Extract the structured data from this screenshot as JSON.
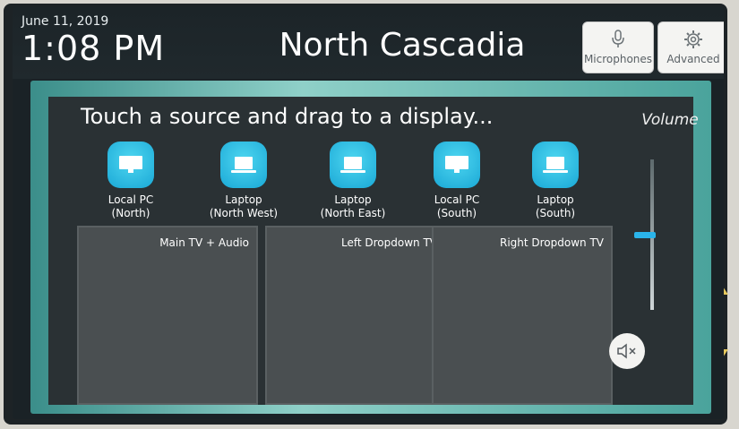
{
  "header": {
    "date": "June 11, 2019",
    "time": "1:08 PM",
    "room_name": "North Cascadia",
    "buttons": [
      {
        "label": "Microphones",
        "icon": "microphone-icon"
      },
      {
        "label": "Advanced",
        "icon": "gear-icon"
      }
    ]
  },
  "instruction": "Touch a source and drag to a display...",
  "sources": [
    {
      "line1": "Local PC",
      "line2": "(North)",
      "icon": "monitor-icon"
    },
    {
      "line1": "Laptop",
      "line2": "(North West)",
      "icon": "laptop-icon"
    },
    {
      "line1": "Laptop",
      "line2": "(North East)",
      "icon": "laptop-icon"
    },
    {
      "line1": "Local PC",
      "line2": "(South)",
      "icon": "monitor-icon"
    },
    {
      "line1": "Laptop",
      "line2": "(South)",
      "icon": "laptop-icon"
    }
  ],
  "displays": [
    {
      "label": "Main TV + Audio"
    },
    {
      "label": "Left Dropdown TV"
    },
    {
      "label": "Right Dropdown TV"
    }
  ],
  "volume": {
    "title": "Volume",
    "level": 0.5,
    "mute_icon": "speaker-mute-icon"
  },
  "colors": {
    "accent": "#1aa8d6",
    "rim": "#8fd0c8",
    "panel": "#2a3134",
    "display": "#4a4f51"
  }
}
